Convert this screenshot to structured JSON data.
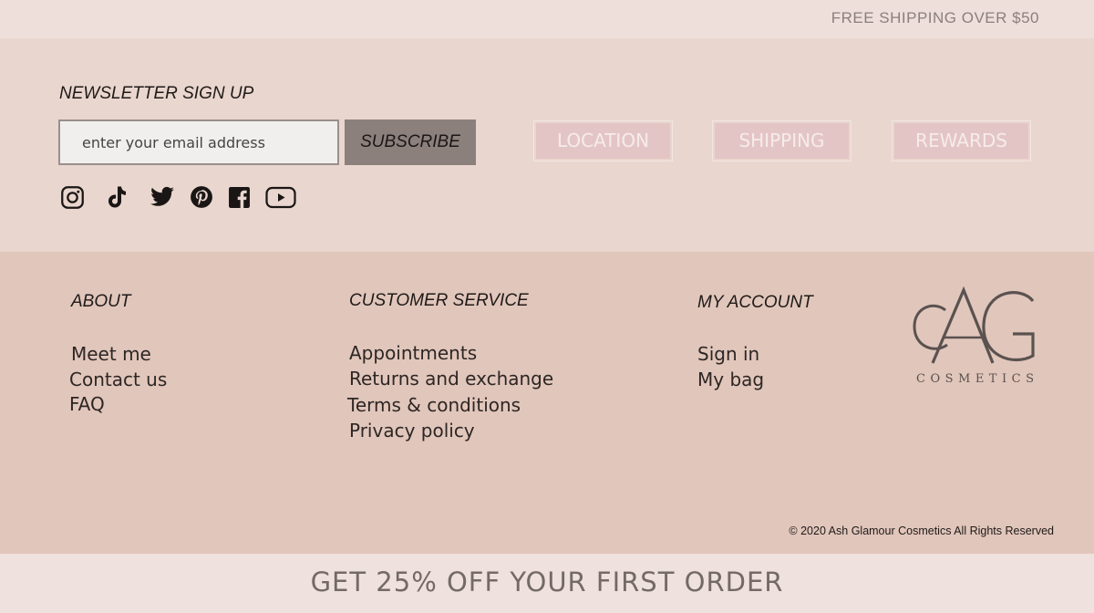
{
  "topbar": {
    "shipping_text": "FREE SHIPPING OVER $50"
  },
  "newsletter": {
    "title": "NEWSLETTER SIGN UP",
    "email_placeholder": "enter your email address",
    "subscribe_label": "SUBSCRIBE"
  },
  "nav_buttons": {
    "location": "LOCATION",
    "shipping": "SHIPPING",
    "rewards": "REWARDS"
  },
  "social": [
    "instagram-icon",
    "tiktok-icon",
    "twitter-icon",
    "pinterest-icon",
    "facebook-icon",
    "youtube-icon"
  ],
  "footer": {
    "about": {
      "title": "ABOUT",
      "links": [
        "Meet me",
        "Contact us",
        "FAQ"
      ]
    },
    "customer_service": {
      "title": "CUSTOMER SERVICE",
      "links": [
        "Appointments",
        "Returns and exchange",
        "Terms & conditions",
        "Privacy policy"
      ]
    },
    "my_account": {
      "title": "MY ACCOUNT",
      "links": [
        "Sign in",
        "My bag"
      ]
    }
  },
  "logo": {
    "monogram": "AG",
    "subtitle": "COSMETICS"
  },
  "copyright": "© 2020 Ash Glamour Cosmetics All Rights Reserved",
  "promo": "GET 25% OFF YOUR FIRST ORDER",
  "colors": {
    "accent_button": "#8c807d",
    "nav_button": "#e4c5c5",
    "background_upper": "#e9d6ce",
    "background_lower": "#e1c6bb"
  }
}
